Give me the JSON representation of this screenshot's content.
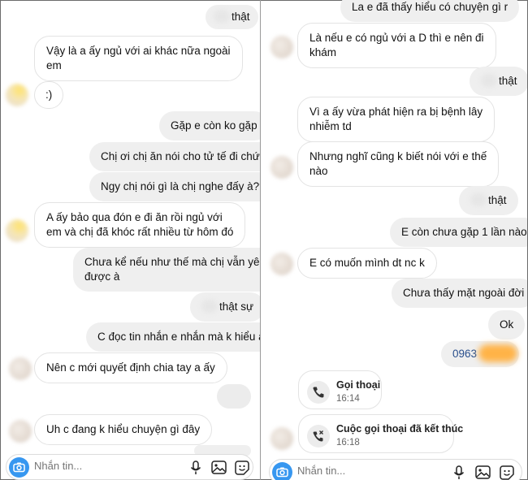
{
  "left_panel": {
    "messages": [
      {
        "id": "l0",
        "side": "sent",
        "text": "thật",
        "has_blur_prefix": true
      },
      {
        "id": "l1",
        "side": "received",
        "line1": "Vậy là a ấy ngủ với ai khác nữa ngoài",
        "line2": "em"
      },
      {
        "id": "l2",
        "side": "received",
        "text": ":)"
      },
      {
        "id": "l3",
        "side": "sent",
        "text": "Gặp e còn ko gặp"
      },
      {
        "id": "l4",
        "side": "sent",
        "text": "Chị ơi chị ăn nói cho tử tế đi chứ?"
      },
      {
        "id": "l5",
        "side": "sent",
        "text": "Ngy chị nói gì là chị nghe đấy à??"
      },
      {
        "id": "l6",
        "side": "received",
        "line1": "A ấy bảo qua đón e đi ăn rồi ngủ với",
        "line2": "em và chị đã khóc rất nhiều từ hôm đó"
      },
      {
        "id": "l7",
        "side": "sent",
        "line1": "Chưa kể nếu như thế mà chị vẫn yêu",
        "line2": "được à"
      },
      {
        "id": "l8",
        "side": "sent",
        "text": "thật sự",
        "has_blur_prefix": true
      },
      {
        "id": "l9",
        "side": "sent",
        "text": "C đọc tin nhắn e nhắn mà k hiểu à"
      },
      {
        "id": "l10",
        "side": "received",
        "text": "Nên c mới quyết định chia tay a ấy"
      },
      {
        "id": "l11",
        "side": "received",
        "text": "Uh c đang k hiểu chuyện gì đây"
      }
    ],
    "composer": {
      "placeholder": "Nhắn tin..."
    }
  },
  "right_panel": {
    "messages": [
      {
        "id": "r0",
        "side": "sent",
        "text": "La e đã thấy hiểu có chuyện gì r"
      },
      {
        "id": "r1",
        "side": "received",
        "line1": "Là nếu e có ngủ với a D thì e nên đi",
        "line2": "khám"
      },
      {
        "id": "r2",
        "side": "sent",
        "text": "thật",
        "has_blur_prefix": true
      },
      {
        "id": "r3",
        "side": "received",
        "line1": "Vì a ấy vừa phát hiện ra bị bệnh lây",
        "line2": "nhiễm td"
      },
      {
        "id": "r4",
        "side": "received",
        "line1": "Nhưng nghĩ cũng k biết nói với e thế",
        "line2": "nào"
      },
      {
        "id": "r5",
        "side": "sent",
        "text": "thật",
        "has_blur_prefix": true
      },
      {
        "id": "r6",
        "side": "sent",
        "text": "E còn chưa gặp 1 lần nào"
      },
      {
        "id": "r7",
        "side": "received",
        "text": "E có muốn mình dt nc k"
      },
      {
        "id": "r8",
        "side": "sent",
        "text": "Chưa thấy mặt ngoài đời"
      },
      {
        "id": "r9",
        "side": "sent",
        "text": "Ok"
      },
      {
        "id": "r10",
        "side": "sent",
        "text": "0963",
        "type": "phone-link"
      }
    ],
    "calls": [
      {
        "title": "Gọi thoại",
        "time": "16:14",
        "icon": "phone-icon"
      },
      {
        "title": "Cuộc gọi thoại đã kết thúc",
        "time": "16:18",
        "icon": "phone-ended-icon"
      }
    ],
    "composer": {
      "placeholder": "Nhắn tin..."
    }
  },
  "colors": {
    "accent": "#3797f0",
    "sent_bubble": "#efefef",
    "received_bubble": "#ffffff",
    "link": "#2a4f8c"
  }
}
